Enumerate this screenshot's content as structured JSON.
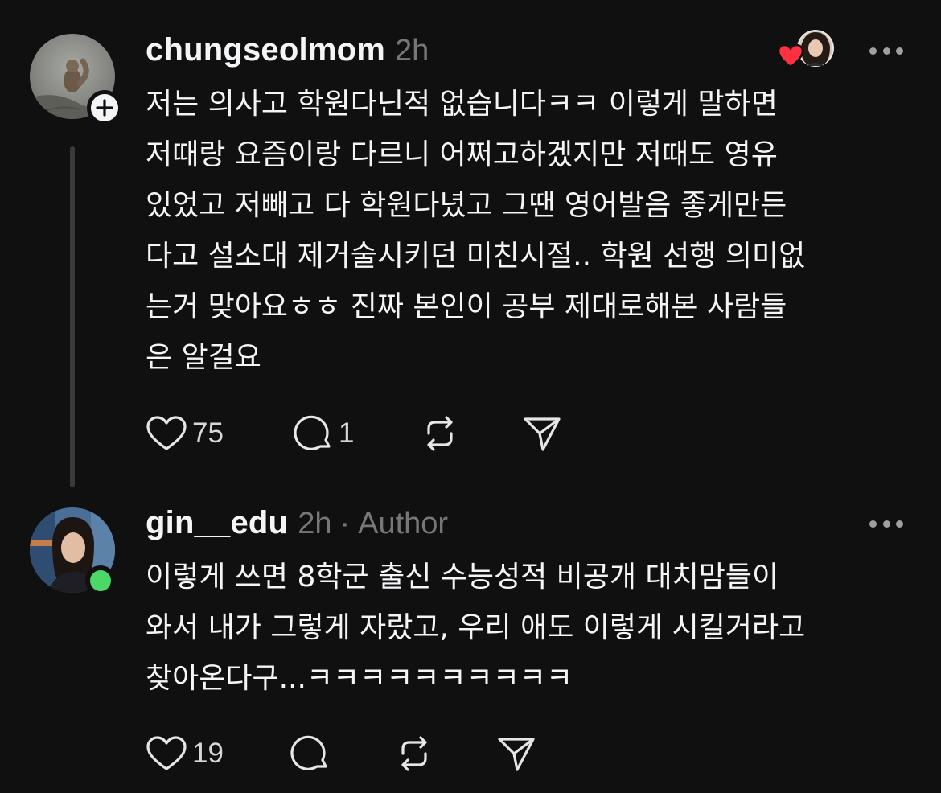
{
  "colors": {
    "background": "#101010",
    "text": "#f3f5f7",
    "muted": "#777777",
    "like_red": "#ff3040",
    "online_green": "#4bd865"
  },
  "posts": [
    {
      "username": "chungseolmom",
      "time": "2h",
      "lines": [
        "저는 의사고 학원다닌적 없습니다ㅋㅋ 이렇게 말하면",
        "저때랑 요즘이랑 다르니 어쩌고하겠지만 저때도 영유",
        "있었고 저빼고 다 학원다녔고 그땐 영어발음 좋게만든",
        "다고 설소대 제거술시키던 미친시절.. 학원 선행 의미없",
        "는거 맞아요ㅎㅎ 진짜 본인이 공부 제대로해본 사람들",
        "은 알걸요"
      ],
      "likes": "75",
      "replies": "1",
      "icons": [
        "follow-plus-icon",
        "liked-by-heart-icon",
        "more-icon",
        "heart-icon",
        "comment-icon",
        "repost-icon",
        "share-icon"
      ]
    },
    {
      "username": "gin__edu",
      "time": "2h",
      "separator": "·",
      "role": "Author",
      "lines": [
        "이렇게 쓰면 8학군 출신 수능성적 비공개 대치맘들이",
        "와서 내가 그렇게 자랐고, 우리 애도 이렇게 시킬거라고",
        "찾아온다구...ㅋㅋㅋㅋㅋㅋㅋㅋㅋㅋ"
      ],
      "likes": "19",
      "icons": [
        "online-status-icon",
        "more-icon",
        "heart-icon",
        "comment-icon",
        "repost-icon",
        "share-icon"
      ]
    }
  ]
}
